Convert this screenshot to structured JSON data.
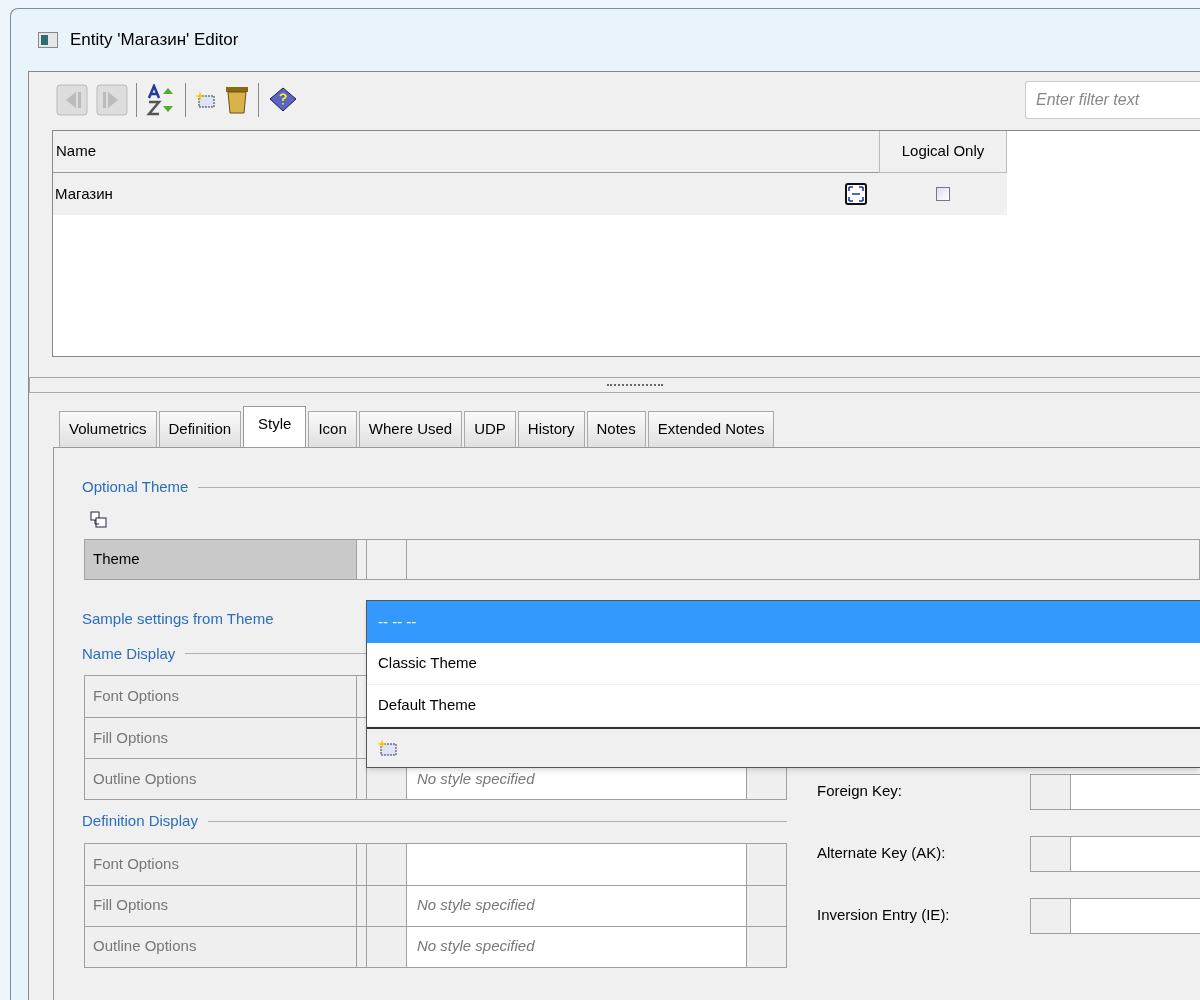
{
  "window": {
    "title": "Entity 'Магазин' Editor"
  },
  "filter": {
    "placeholder": "Enter filter text"
  },
  "table": {
    "columns": [
      "Name",
      "Logical Only"
    ],
    "rows": [
      {
        "name": "Магазин",
        "logical_only": false
      }
    ]
  },
  "tabs": [
    {
      "label": "Volumetrics",
      "selected": false
    },
    {
      "label": "Definition",
      "selected": false
    },
    {
      "label": "Style",
      "selected": true
    },
    {
      "label": "Icon",
      "selected": false
    },
    {
      "label": "Where Used",
      "selected": false
    },
    {
      "label": "UDP",
      "selected": false
    },
    {
      "label": "History",
      "selected": false
    },
    {
      "label": "Notes",
      "selected": false
    },
    {
      "label": "Extended Notes",
      "selected": false
    }
  ],
  "style_tab": {
    "optional_theme_title": "Optional Theme",
    "theme_label": "Theme",
    "theme_dropdown": {
      "options": [
        {
          "label": "-- -- --",
          "selected": true
        },
        {
          "label": "Classic Theme",
          "selected": false
        },
        {
          "label": "Default Theme",
          "selected": false
        }
      ]
    },
    "sample_title": "Sample settings from Theme",
    "sections": [
      {
        "title": "Name Display",
        "rows": [
          {
            "label": "Font Options"
          },
          {
            "label": "Fill Options"
          },
          {
            "label": "Outline Options",
            "value": "No style specified"
          }
        ]
      },
      {
        "title": "Definition Display",
        "rows": [
          {
            "label": "Font Options"
          },
          {
            "label": "Fill Options",
            "value": "No style specified"
          },
          {
            "label": "Outline Options",
            "value": "No style specified"
          }
        ]
      }
    ],
    "key_fields": [
      {
        "label": "Foreign Key:"
      },
      {
        "label": "Alternate Key (AK):"
      },
      {
        "label": "Inversion Entry (IE):"
      }
    ]
  }
}
